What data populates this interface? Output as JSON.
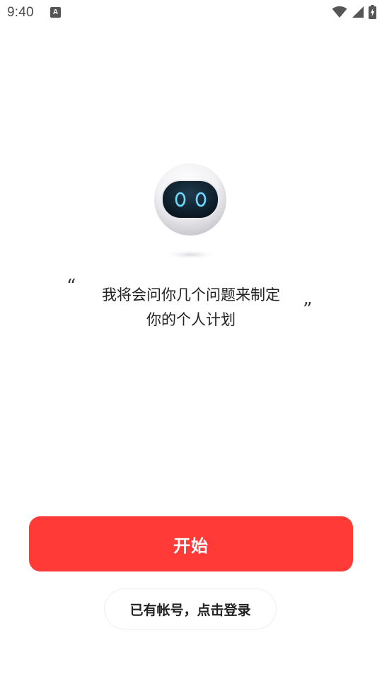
{
  "status_bar": {
    "time": "9:40",
    "notification_icon_letter": "A",
    "icons": [
      "wifi-icon",
      "cellular-signal-icon",
      "battery-charging-icon"
    ]
  },
  "robot": {
    "icon": "robot-mascot-icon",
    "eye_color": "#6fd9ff"
  },
  "message": {
    "open_quote": "“",
    "close_quote": "”",
    "line1": "我将会问你几个问题来制定",
    "line2": "你的个人计划"
  },
  "actions": {
    "start_label": "开始",
    "login_label": "已有帐号，点击登录"
  },
  "colors": {
    "accent": "#ff3a37"
  }
}
